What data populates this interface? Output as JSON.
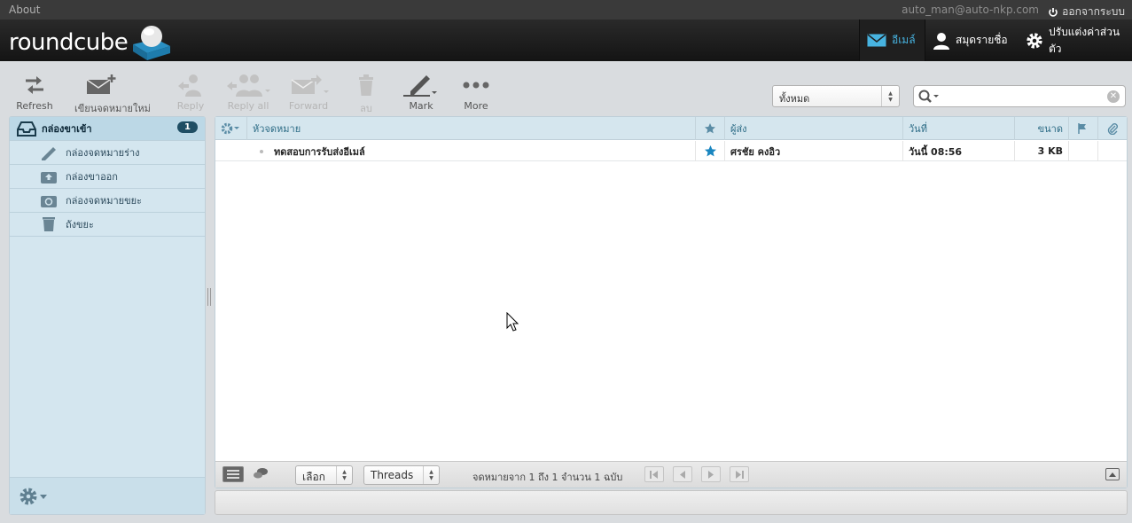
{
  "topline": {
    "about": "About",
    "user": "auto_man@auto-nkp.com",
    "logout": "ออกจากระบบ"
  },
  "logo": {
    "text": "roundcube"
  },
  "taskbar": [
    {
      "label": "อีเมล์",
      "icon": "mail-icon",
      "active": true
    },
    {
      "label": "สมุดรายชื่อ",
      "icon": "contacts-icon",
      "active": false
    },
    {
      "label": "ปรับแต่งค่าส่วนตัว",
      "icon": "settings-gear-icon",
      "active": false
    }
  ],
  "toolbar": {
    "refresh": "Refresh",
    "compose": "เขียนจดหมายใหม่",
    "reply": "Reply",
    "reply_all": "Reply all",
    "forward": "Forward",
    "delete": "ลบ",
    "mark": "Mark",
    "more": "More"
  },
  "filter": {
    "value": "ทั้งหมด"
  },
  "search": {
    "placeholder": ""
  },
  "folders": [
    {
      "label": "กล่องขาเข้า",
      "icon": "inbox-icon",
      "unread": "1",
      "selected": true
    },
    {
      "label": "กล่องจดหมายร่าง",
      "icon": "drafts-pencil-icon"
    },
    {
      "label": "กล่องขาออก",
      "icon": "sent-icon"
    },
    {
      "label": "กล่องจดหมายขยะ",
      "icon": "junk-icon"
    },
    {
      "label": "ถังขยะ",
      "icon": "trash-icon"
    }
  ],
  "list_columns": {
    "subject": "หัวจดหมาย",
    "from": "ผู้ส่ง",
    "date": "วันที่",
    "size": "ขนาด"
  },
  "messages": [
    {
      "subject": "ทดสอบการรับส่งอีเมล์",
      "flagged": true,
      "from": "ศรชัย คงอิว",
      "date": "วันนี้ 08:56",
      "size": "3 KB"
    }
  ],
  "list_footer": {
    "select": "เลือก",
    "threads": "Threads",
    "count": "จดหมายจาก 1 ถึง 1 จำนวน 1 ฉบับ"
  },
  "colors": {
    "accent": "#47b3e0",
    "folder_bg": "#d4e6ef",
    "header_bg": "#1a1a1a",
    "badge": "#1f4e64"
  }
}
